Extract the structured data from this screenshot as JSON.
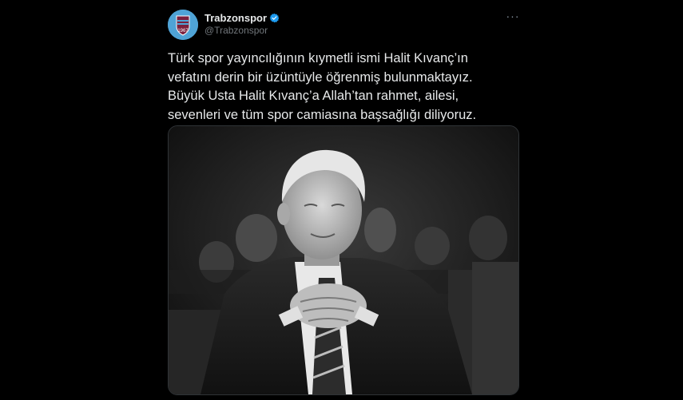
{
  "account": {
    "display_name": "Trabzonspor",
    "handle": "@Trabzonspor",
    "verified": true,
    "avatar_color": "#4fa3d6",
    "avatar_icon": "trabzonspor-crest-icon"
  },
  "menu": {
    "icon": "more-horizontal-icon",
    "glyph": "···"
  },
  "tweet": {
    "lines": [
      "Türk spor yayıncılığının kıymetli ismi Halit Kıvanç’ın",
      "vefatını derin bir üzüntüyle öğrenmiş bulunmaktayız.",
      "Büyük Usta Halit Kıvanç’a Allah’tan rahmet, ailesi,",
      "sevenleri ve tüm spor camiasına başsağlığı diliyoruz."
    ]
  },
  "media": {
    "type": "photo",
    "style": "black-and-white"
  },
  "colors": {
    "background": "#000000",
    "text": "#e7e9ea",
    "secondary_text": "#71767b",
    "verified_badge": "#1d9bf0",
    "border": "#2f3336"
  }
}
